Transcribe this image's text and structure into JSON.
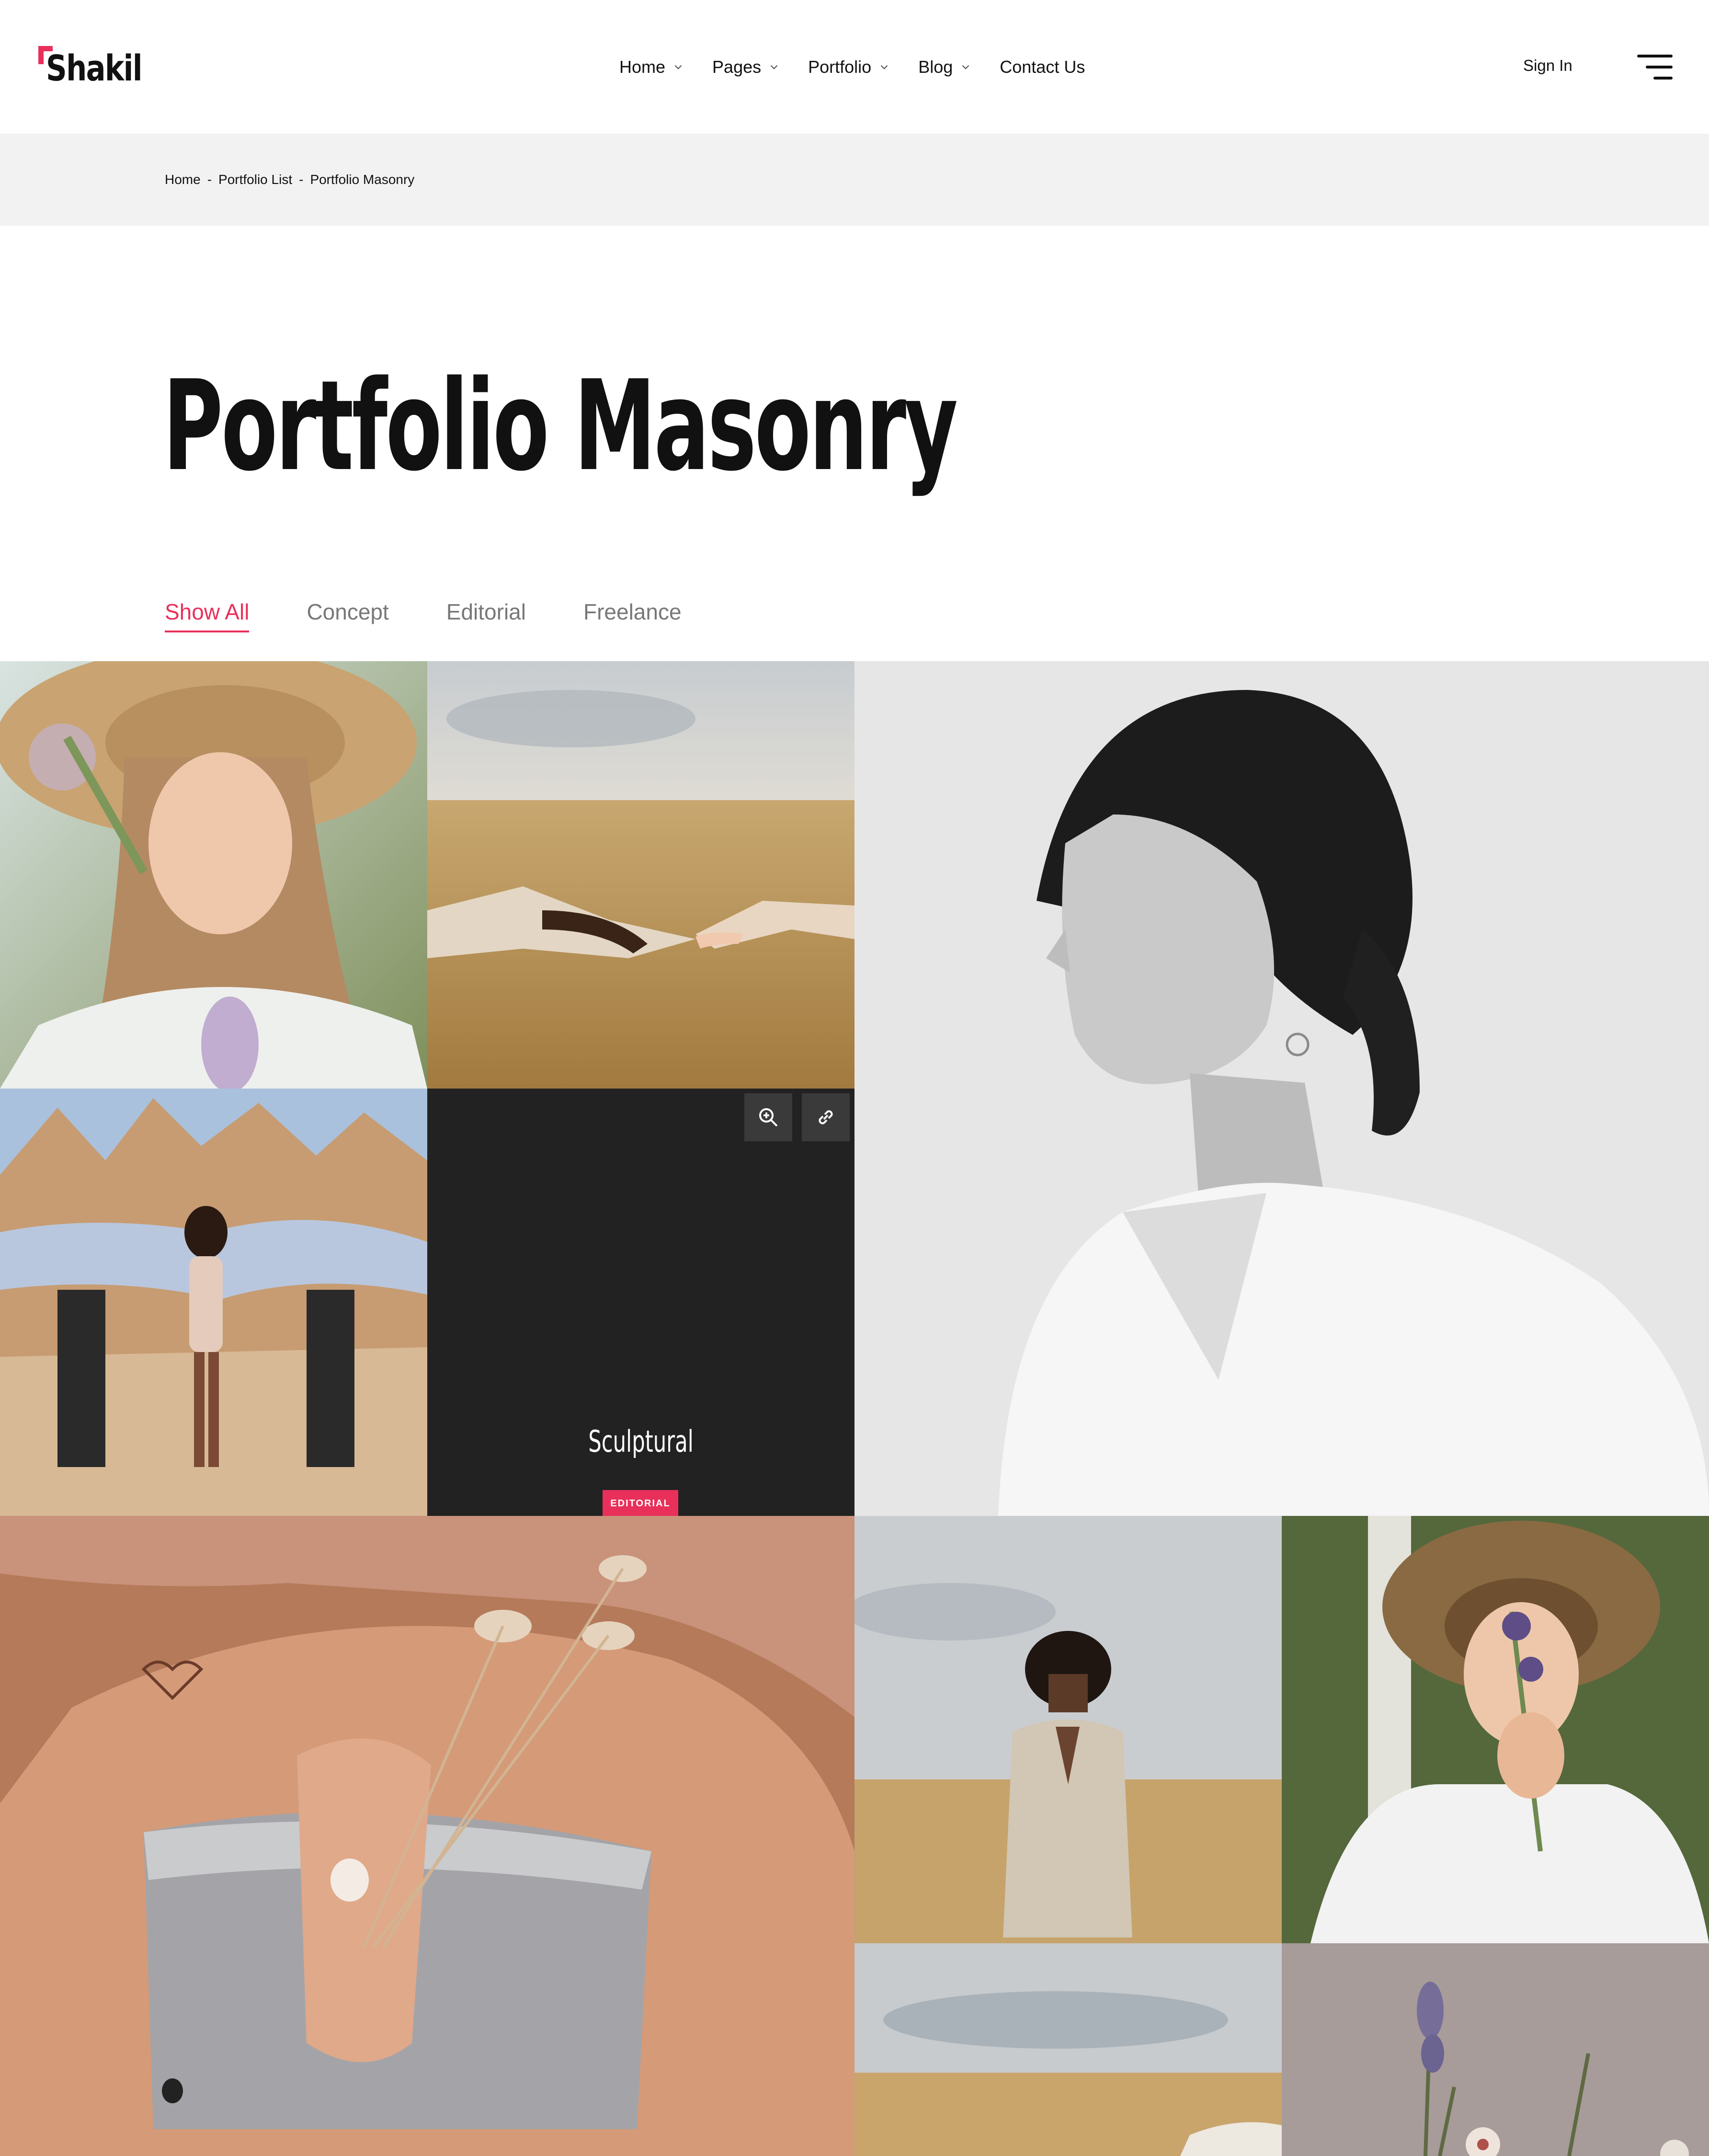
{
  "header": {
    "logo_text": "Shakil",
    "nav": [
      {
        "label": "Home",
        "has_dropdown": true
      },
      {
        "label": "Pages",
        "has_dropdown": true
      },
      {
        "label": "Portfolio",
        "has_dropdown": true
      },
      {
        "label": "Blog",
        "has_dropdown": true
      },
      {
        "label": "Contact Us",
        "has_dropdown": false
      }
    ],
    "sign_in": "Sign In",
    "menu_icon": "hamburger-menu-icon"
  },
  "breadcrumb": [
    "Home",
    "Portfolio List",
    "Portfolio Masonry"
  ],
  "breadcrumb_separator": "-",
  "page_title": "Portfolio Masonry",
  "filters": [
    {
      "label": "Show All",
      "active": true
    },
    {
      "label": "Concept",
      "active": false
    },
    {
      "label": "Editorial",
      "active": false
    },
    {
      "label": "Freelance",
      "active": false
    }
  ],
  "hover_item": {
    "title": "Sculptural",
    "category": "EDITORIAL",
    "zoom_icon": "zoom-in-icon",
    "link_icon": "link-icon"
  },
  "colors": {
    "accent": "#e8305a",
    "text": "#111111",
    "breadcrumb_bg": "#f2f2f2",
    "overlay": "#222222"
  }
}
